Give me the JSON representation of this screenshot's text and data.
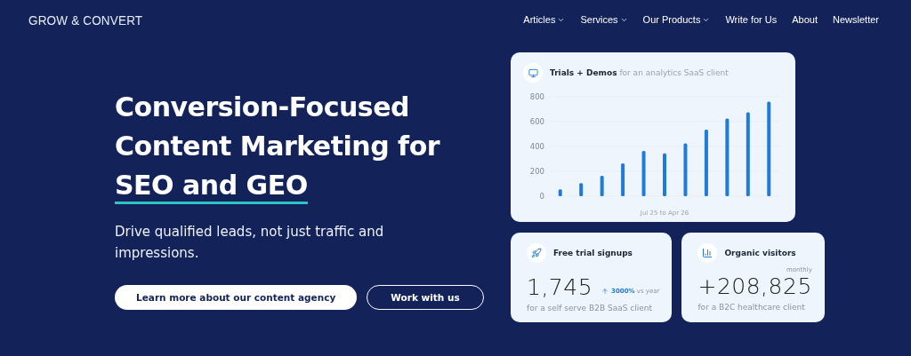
{
  "logo": "GROW & CONVERT",
  "nav": [
    {
      "label": "Articles",
      "dropdown": true
    },
    {
      "label": "Services",
      "dropdown": true
    },
    {
      "label": "Our Products",
      "dropdown": true
    },
    {
      "label": "Write for Us",
      "dropdown": false
    },
    {
      "label": "About",
      "dropdown": false
    },
    {
      "label": "Newsletter",
      "dropdown": false
    }
  ],
  "hero": {
    "headline": "Conversion-Focused Content Marketing for",
    "highlight": "SEO and GEO",
    "subtitle": "Drive qualified leads, not just traffic and impressions.",
    "buttons": [
      {
        "label": "Learn more about our content agency",
        "kind": "primary"
      },
      {
        "label": "Work with us",
        "kind": "outline"
      }
    ]
  },
  "chart_card": {
    "title": "Trials + Demos",
    "subtitle": "for an analytics SaaS client",
    "chart_data": {
      "type": "bar",
      "xlabel": "Jul 25 to Apr 26",
      "ylim": [
        0,
        800
      ],
      "yticks": [
        0,
        200,
        400,
        600,
        800
      ],
      "categories": [
        null,
        null,
        null,
        null,
        null,
        null,
        null,
        null,
        null,
        null,
        null
      ],
      "series": [
        {
          "color": "#1f7ad8",
          "values": [
            55,
            105,
            165,
            265,
            365,
            345,
            425,
            535,
            625,
            675,
            760
          ]
        }
      ]
    }
  },
  "stat_cards": [
    {
      "title": "Free trial signups",
      "value": "1,745",
      "change": "3000%",
      "change_note": "vs year",
      "note": "for a self serve B2B SaaS client"
    },
    {
      "title": "Organic visitors",
      "period": "monthly",
      "value": "+208,825",
      "note": "for a B2C healthcare client"
    }
  ]
}
